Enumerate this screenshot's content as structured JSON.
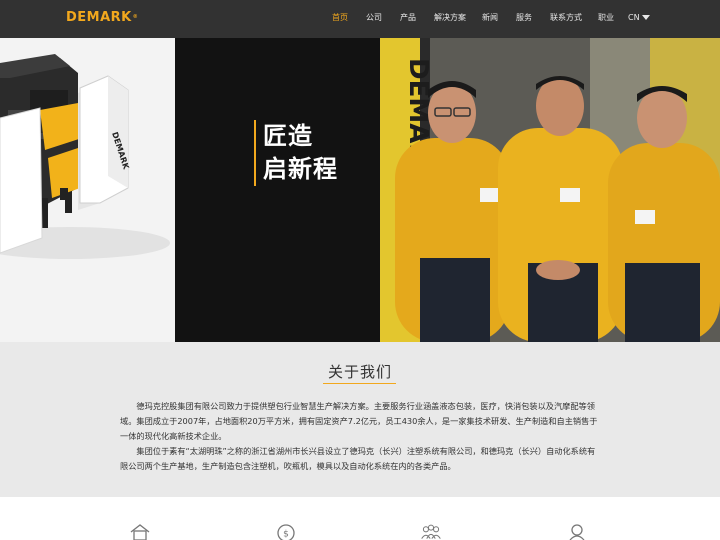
{
  "brand": {
    "logo_text": "DEMARK",
    "logo_mark": "®",
    "hero_banner_text": "DEMARK",
    "accent_color": "#f2a81d"
  },
  "nav": {
    "items": [
      {
        "label": "首页",
        "active": true
      },
      {
        "label": "公司"
      },
      {
        "label": "产品"
      },
      {
        "label": "解决方案"
      },
      {
        "label": "新闻"
      },
      {
        "label": "服务"
      },
      {
        "label": "联系方式"
      },
      {
        "label": "职业"
      }
    ],
    "language": "CN",
    "language_icon": "caret-down-icon"
  },
  "hero": {
    "headline_line1": "匠造",
    "headline_line2": "启新程",
    "machine_label": "DEMARK",
    "slides_total": 3,
    "active_slide": 3
  },
  "about": {
    "title": "关于我们",
    "paragraphs": [
      "德玛克控股集团有限公司致力于提供塑包行业智慧生产解决方案。主要服务行业涵盖液态包装，医疗，快消包装以及汽摩配等领域。集团成立于2007年，占地面积20万平方米，拥有固定资产7.2亿元，员工430余人，是一家集技术研发、生产制造和自主销售于一体的现代化高新技术企业。",
      "集团位于素有“太湖明珠”之称的浙江省湖州市长兴县设立了德玛克（长兴）注塑系统有限公司，和德玛克（长兴）自动化系统有限公司两个生产基地，生产制造包含注塑机，吹瓶机，模具以及自动化系统在内的各类产品。"
    ]
  },
  "features": [
    {
      "icon": "home-icon"
    },
    {
      "icon": "dollar-coin-icon"
    },
    {
      "icon": "team-icon"
    },
    {
      "icon": "user-icon"
    }
  ]
}
